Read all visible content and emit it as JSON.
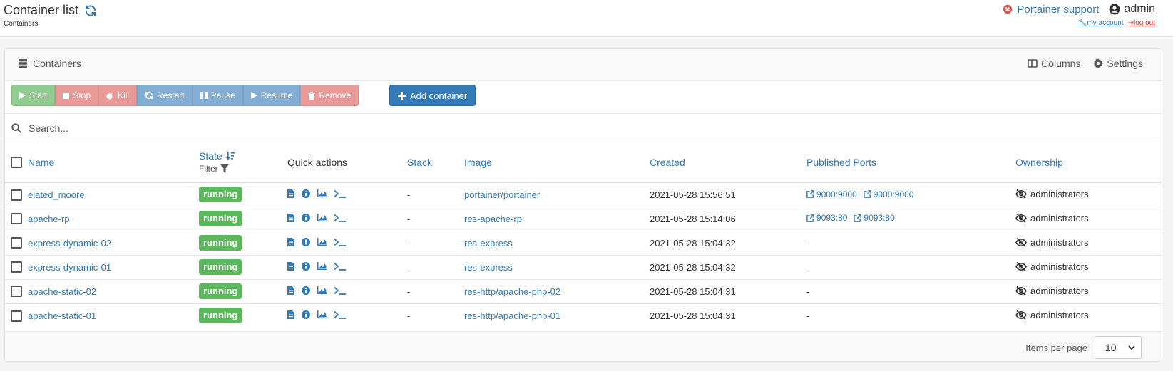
{
  "header": {
    "title": "Container list",
    "breadcrumb": "Containers",
    "support_label": "Portainer support",
    "user": "admin",
    "my_account": "my account",
    "log_out": "log out"
  },
  "widget": {
    "title": "Containers",
    "columns_label": "Columns",
    "settings_label": "Settings"
  },
  "actions": {
    "start": "Start",
    "stop": "Stop",
    "kill": "Kill",
    "restart": "Restart",
    "pause": "Pause",
    "resume": "Resume",
    "remove": "Remove",
    "add": "Add container"
  },
  "search": {
    "placeholder": "Search..."
  },
  "table": {
    "headers": {
      "name": "Name",
      "state": "State",
      "filter": "Filter",
      "quick_actions": "Quick actions",
      "stack": "Stack",
      "image": "Image",
      "created": "Created",
      "ports": "Published Ports",
      "ownership": "Ownership"
    },
    "rows": [
      {
        "name": "elated_moore",
        "state": "running",
        "stack": "-",
        "image": "portainer/portainer",
        "created": "2021-05-28 15:56:51",
        "ports": [
          "9000:9000",
          "9000:9000"
        ],
        "ports_empty": "",
        "ownership": "administrators"
      },
      {
        "name": "apache-rp",
        "state": "running",
        "stack": "-",
        "image": "res-apache-rp",
        "created": "2021-05-28 15:14:06",
        "ports": [
          "9093:80",
          "9093:80"
        ],
        "ports_empty": "",
        "ownership": "administrators"
      },
      {
        "name": "express-dynamic-02",
        "state": "running",
        "stack": "-",
        "image": "res-express",
        "created": "2021-05-28 15:04:32",
        "ports": [],
        "ports_empty": "-",
        "ownership": "administrators"
      },
      {
        "name": "express-dynamic-01",
        "state": "running",
        "stack": "-",
        "image": "res-express",
        "created": "2021-05-28 15:04:32",
        "ports": [],
        "ports_empty": "-",
        "ownership": "administrators"
      },
      {
        "name": "apache-static-02",
        "state": "running",
        "stack": "-",
        "image": "res-http/apache-php-02",
        "created": "2021-05-28 15:04:31",
        "ports": [],
        "ports_empty": "-",
        "ownership": "administrators"
      },
      {
        "name": "apache-static-01",
        "state": "running",
        "stack": "-",
        "image": "res-http/apache-php-01",
        "created": "2021-05-28 15:04:31",
        "ports": [],
        "ports_empty": "-",
        "ownership": "administrators"
      }
    ]
  },
  "footer": {
    "items_per_page_label": "Items per page",
    "items_per_page_value": "10"
  },
  "colors": {
    "link": "#337ab7",
    "running": "#5cb85c",
    "danger": "#d9534f"
  }
}
